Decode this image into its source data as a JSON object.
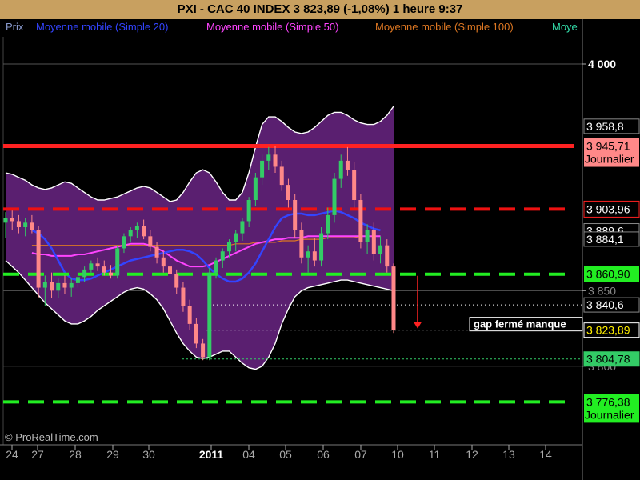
{
  "header": {
    "title": "PXI - CAC 40 INDEX     3 823,89 (-1,08%)     1 heure  9:37"
  },
  "legend": [
    {
      "label": "Prix",
      "color": "#8899cc"
    },
    {
      "label": "Moyenne mobile (Simple 20)",
      "color": "#3344ff"
    },
    {
      "label": "Moyenne mobile (Simple 50)",
      "color": "#ff44ff"
    },
    {
      "label": "Moyenne mobile (Simple 100)",
      "color": "#dd7722"
    },
    {
      "label": "Moye",
      "color": "#33ddaa"
    }
  ],
  "footer": {
    "watermark": "© ProRealTime.com"
  },
  "annotations": {
    "gap_note": "gap fermé manque"
  },
  "chart_data": {
    "type": "candlestick",
    "x_tick_labels": [
      "24",
      "27",
      "28",
      "29",
      "30",
      "2011",
      "04",
      "05",
      "06",
      "07",
      "10",
      "11",
      "12",
      "13",
      "14"
    ],
    "y_tick_labels": [
      {
        "value": 4000,
        "label": "4 000"
      },
      {
        "value": 3850,
        "label": "3 850"
      },
      {
        "value": 3800,
        "label": "3 800"
      }
    ],
    "ylim": [
      3748,
      4018
    ],
    "colors": {
      "bullish": "#33cc66",
      "bearish": "#ff8888",
      "band_fill": "#5a1f70",
      "band_line": "#ffffff"
    },
    "price_levels": [
      {
        "value": 3945.71,
        "label": "3 945,71",
        "sublabel": "Journalier",
        "style": "solid",
        "color": "#ff2222",
        "label_bg": "#ff8888",
        "label_fg": "#000000"
      },
      {
        "value": 3903.96,
        "label": "3 903,96",
        "style": "dashed",
        "color": "#ee1111",
        "label_bg": "#000000",
        "label_fg": "#ffffff",
        "label_border": "#ff2222"
      },
      {
        "value": 3860.9,
        "label": "3 860,90",
        "style": "dashed",
        "color": "#22ee22",
        "label_bg": "#22ee22",
        "label_fg": "#000000"
      },
      {
        "value": 3776.38,
        "label": "3 776,38",
        "sublabel": "Journalier",
        "style": "dashed",
        "color": "#22ee22",
        "label_bg": "#22ee22",
        "label_fg": "#000000"
      }
    ],
    "indicator_labels": [
      {
        "value": 3958.8,
        "label": "3 958,8",
        "bg": "#000000",
        "fg": "#ffffff",
        "border": "#888888"
      },
      {
        "value": 3889.6,
        "label": "3 889,6",
        "bg": "#000000",
        "fg": "#ffffff",
        "border": "#888888"
      },
      {
        "value": 3884.1,
        "label": "3 884,1",
        "bg": "#000000",
        "fg": "#ffffff",
        "border": "#888888"
      },
      {
        "value": 3840.6,
        "label": "3 840,6",
        "bg": "#000000",
        "fg": "#ffffff",
        "border": "#888888"
      },
      {
        "value": 3823.89,
        "label": "3 823,89",
        "bg": "#000000",
        "fg": "#ffee00",
        "border": "#ffffff"
      },
      {
        "value": 3804.78,
        "label": "3 804,78",
        "bg": "#33cc66",
        "fg": "#000000",
        "border": "#33cc66"
      }
    ],
    "gap_levels": [
      3840.6,
      3823.89,
      3804.78
    ],
    "candles": [
      {
        "o": 3895,
        "h": 3902,
        "l": 3885,
        "c": 3898
      },
      {
        "o": 3898,
        "h": 3903,
        "l": 3890,
        "c": 3896
      },
      {
        "o": 3896,
        "h": 3900,
        "l": 3888,
        "c": 3892
      },
      {
        "o": 3892,
        "h": 3898,
        "l": 3886,
        "c": 3895
      },
      {
        "o": 3895,
        "h": 3900,
        "l": 3888,
        "c": 3890
      },
      {
        "o": 3890,
        "h": 3893,
        "l": 3845,
        "c": 3852
      },
      {
        "o": 3852,
        "h": 3860,
        "l": 3840,
        "c": 3856
      },
      {
        "o": 3856,
        "h": 3862,
        "l": 3845,
        "c": 3850
      },
      {
        "o": 3850,
        "h": 3858,
        "l": 3845,
        "c": 3855
      },
      {
        "o": 3855,
        "h": 3860,
        "l": 3848,
        "c": 3852
      },
      {
        "o": 3852,
        "h": 3858,
        "l": 3846,
        "c": 3855
      },
      {
        "o": 3855,
        "h": 3862,
        "l": 3852,
        "c": 3859
      },
      {
        "o": 3859,
        "h": 3866,
        "l": 3856,
        "c": 3864
      },
      {
        "o": 3864,
        "h": 3870,
        "l": 3862,
        "c": 3868
      },
      {
        "o": 3868,
        "h": 3872,
        "l": 3863,
        "c": 3866
      },
      {
        "o": 3866,
        "h": 3870,
        "l": 3860,
        "c": 3862
      },
      {
        "o": 3862,
        "h": 3867,
        "l": 3858,
        "c": 3860
      },
      {
        "o": 3860,
        "h": 3880,
        "l": 3858,
        "c": 3878
      },
      {
        "o": 3878,
        "h": 3888,
        "l": 3875,
        "c": 3886
      },
      {
        "o": 3886,
        "h": 3892,
        "l": 3882,
        "c": 3890
      },
      {
        "o": 3890,
        "h": 3895,
        "l": 3885,
        "c": 3893
      },
      {
        "o": 3893,
        "h": 3897,
        "l": 3884,
        "c": 3886
      },
      {
        "o": 3886,
        "h": 3890,
        "l": 3876,
        "c": 3879
      },
      {
        "o": 3879,
        "h": 3882,
        "l": 3868,
        "c": 3872
      },
      {
        "o": 3872,
        "h": 3876,
        "l": 3862,
        "c": 3866
      },
      {
        "o": 3866,
        "h": 3870,
        "l": 3858,
        "c": 3861
      },
      {
        "o": 3861,
        "h": 3864,
        "l": 3848,
        "c": 3852
      },
      {
        "o": 3852,
        "h": 3856,
        "l": 3836,
        "c": 3840
      },
      {
        "o": 3840,
        "h": 3844,
        "l": 3824,
        "c": 3828
      },
      {
        "o": 3828,
        "h": 3832,
        "l": 3812,
        "c": 3815
      },
      {
        "o": 3815,
        "h": 3818,
        "l": 3804,
        "c": 3806
      },
      {
        "o": 3806,
        "h": 3865,
        "l": 3804,
        "c": 3862
      },
      {
        "o": 3862,
        "h": 3872,
        "l": 3858,
        "c": 3870
      },
      {
        "o": 3870,
        "h": 3878,
        "l": 3865,
        "c": 3876
      },
      {
        "o": 3876,
        "h": 3884,
        "l": 3872,
        "c": 3882
      },
      {
        "o": 3882,
        "h": 3890,
        "l": 3876,
        "c": 3888
      },
      {
        "o": 3888,
        "h": 3898,
        "l": 3883,
        "c": 3896
      },
      {
        "o": 3896,
        "h": 3912,
        "l": 3892,
        "c": 3910
      },
      {
        "o": 3910,
        "h": 3928,
        "l": 3906,
        "c": 3925
      },
      {
        "o": 3925,
        "h": 3940,
        "l": 3920,
        "c": 3936
      },
      {
        "o": 3936,
        "h": 3945,
        "l": 3930,
        "c": 3940
      },
      {
        "o": 3940,
        "h": 3946,
        "l": 3928,
        "c": 3932
      },
      {
        "o": 3932,
        "h": 3936,
        "l": 3916,
        "c": 3920
      },
      {
        "o": 3920,
        "h": 3924,
        "l": 3905,
        "c": 3910
      },
      {
        "o": 3910,
        "h": 3914,
        "l": 3885,
        "c": 3890
      },
      {
        "o": 3890,
        "h": 3895,
        "l": 3868,
        "c": 3872
      },
      {
        "o": 3872,
        "h": 3880,
        "l": 3862,
        "c": 3876
      },
      {
        "o": 3876,
        "h": 3885,
        "l": 3866,
        "c": 3870
      },
      {
        "o": 3870,
        "h": 3892,
        "l": 3866,
        "c": 3888
      },
      {
        "o": 3888,
        "h": 3905,
        "l": 3884,
        "c": 3900
      },
      {
        "o": 3900,
        "h": 3928,
        "l": 3895,
        "c": 3924
      },
      {
        "o": 3924,
        "h": 3940,
        "l": 3918,
        "c": 3936
      },
      {
        "o": 3936,
        "h": 3945,
        "l": 3926,
        "c": 3930
      },
      {
        "o": 3930,
        "h": 3935,
        "l": 3905,
        "c": 3910
      },
      {
        "o": 3910,
        "h": 3914,
        "l": 3878,
        "c": 3882
      },
      {
        "o": 3882,
        "h": 3894,
        "l": 3874,
        "c": 3890
      },
      {
        "o": 3890,
        "h": 3895,
        "l": 3870,
        "c": 3874
      },
      {
        "o": 3874,
        "h": 3886,
        "l": 3868,
        "c": 3880
      },
      {
        "o": 3880,
        "h": 3884,
        "l": 3862,
        "c": 3866
      },
      {
        "o": 3866,
        "h": 3868,
        "l": 3822,
        "c": 3824
      }
    ],
    "sma20": [
      3890,
      3888,
      3884,
      3878,
      3870,
      3862,
      3858,
      3857,
      3857,
      3858,
      3860,
      3862,
      3864,
      3866,
      3868,
      3870,
      3871,
      3872,
      3873,
      3874,
      3875,
      3876,
      3877,
      3877,
      3876,
      3874,
      3870,
      3865,
      3861,
      3858,
      3856,
      3856,
      3858,
      3862,
      3868,
      3876,
      3884,
      3892,
      3898,
      3900,
      3901,
      3901,
      3900,
      3900,
      3901,
      3902,
      3903,
      3902,
      3900,
      3898,
      3895,
      3893,
      3891,
      3890
    ],
    "sma50": [
      3875,
      3874,
      3874,
      3873,
      3873,
      3873,
      3873,
      3874,
      3874,
      3875,
      3876,
      3877,
      3878,
      3879,
      3880,
      3881,
      3881,
      3881,
      3880,
      3878,
      3876,
      3873,
      3870,
      3868,
      3866,
      3866,
      3866,
      3867,
      3869,
      3871,
      3873,
      3875,
      3877,
      3879,
      3881,
      3882,
      3883,
      3884,
      3884,
      3885,
      3885,
      3885,
      3886,
      3886,
      3886,
      3886,
      3886,
      3886,
      3886,
      3886,
      3886,
      3886,
      3886,
      3886
    ],
    "sma100": [
      3880,
      3880,
      3880,
      3880,
      3880,
      3880,
      3880,
      3880,
      3880,
      3880,
      3880,
      3880,
      3880,
      3880,
      3880,
      3880,
      3880,
      3880,
      3880,
      3880,
      3880,
      3880,
      3880,
      3880,
      3880,
      3880,
      3880,
      3880,
      3880,
      3880,
      3880,
      3881,
      3881,
      3881,
      3882,
      3882,
      3882,
      3882,
      3883,
      3883,
      3883,
      3884,
      3884,
      3884,
      3884,
      3885,
      3885,
      3885,
      3885,
      3885,
      3886,
      3886,
      3886,
      3886
    ],
    "band_upper": [
      3928,
      3927,
      3925,
      3923,
      3920,
      3918,
      3917,
      3918,
      3920,
      3922,
      3921,
      3918,
      3915,
      3912,
      3910,
      3910,
      3911,
      3912,
      3914,
      3916,
      3918,
      3919,
      3918,
      3915,
      3912,
      3909,
      3910,
      3915,
      3922,
      3928,
      3930,
      3928,
      3922,
      3915,
      3910,
      3910,
      3915,
      3928,
      3945,
      3960,
      3965,
      3965,
      3962,
      3958,
      3955,
      3954,
      3955,
      3958,
      3962,
      3966,
      3968,
      3968,
      3966,
      3963,
      3961,
      3960,
      3960,
      3962,
      3966,
      3972
    ],
    "band_lower": [
      3870,
      3866,
      3862,
      3857,
      3852,
      3847,
      3842,
      3838,
      3834,
      3830,
      3828,
      3828,
      3830,
      3833,
      3837,
      3840,
      3843,
      3846,
      3849,
      3851,
      3852,
      3851,
      3848,
      3844,
      3838,
      3830,
      3822,
      3815,
      3810,
      3806,
      3805,
      3806,
      3808,
      3810,
      3810,
      3806,
      3802,
      3799,
      3798,
      3800,
      3806,
      3815,
      3828,
      3838,
      3846,
      3850,
      3852,
      3853,
      3854,
      3855,
      3856,
      3857,
      3857,
      3856,
      3855,
      3854,
      3853,
      3852,
      3851,
      3850
    ]
  }
}
